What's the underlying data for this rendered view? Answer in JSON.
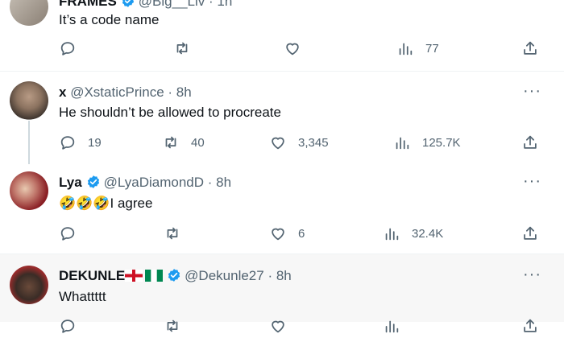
{
  "tweets": [
    {
      "name": "FRAMES",
      "handle": "@Big__Liv",
      "time": "· 1h",
      "text": "It’s a code name",
      "replies": "",
      "retweets": "",
      "likes": "",
      "views": "77"
    },
    {
      "name": "x",
      "handle": "@XstaticPrince",
      "time": "· 8h",
      "text": "He shouldn’t be allowed to procreate",
      "replies": "19",
      "retweets": "40",
      "likes": "3,345",
      "views": "125.7K"
    },
    {
      "name": "Lya",
      "handle": "@LyaDiamondD",
      "time": "· 8h",
      "emoji": "🤣🤣🤣",
      "text": "I agree",
      "replies": "",
      "retweets": "",
      "likes": "6",
      "views": "32.4K"
    },
    {
      "name": "DEKUNLE",
      "handle": "@Dekunle27",
      "time": "· 8h",
      "text": "Whattttt"
    }
  ],
  "colors": {
    "text": "#0f1419",
    "secondary": "#536471",
    "verified": "#1d9bf0",
    "divider": "#eff3f4",
    "thread": "#cfd9de"
  },
  "icons": [
    "reply-icon",
    "retweet-icon",
    "like-icon",
    "views-icon",
    "share-icon",
    "more-icon",
    "verified-icon"
  ]
}
